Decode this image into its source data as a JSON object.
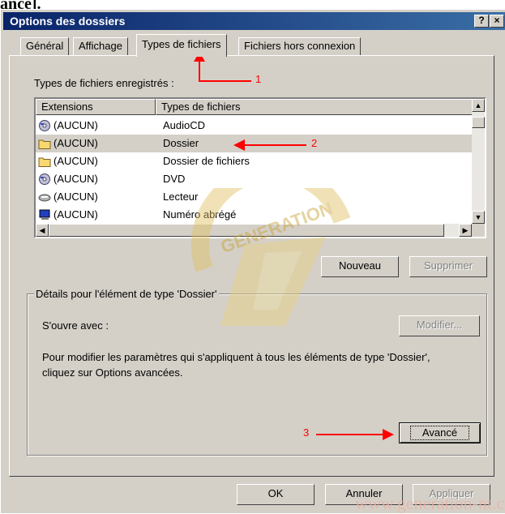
{
  "page_top_fragment": "ancé].",
  "window": {
    "title": "Options des dossiers",
    "help_label": "?",
    "close_label": "×"
  },
  "tabs": [
    {
      "label": "Général"
    },
    {
      "label": "Affichage"
    },
    {
      "label": "Types de fichiers"
    },
    {
      "label": "Fichiers hors connexion"
    }
  ],
  "registered_label": "Types de fichiers enregistrés :",
  "list": {
    "columns": [
      "Extensions",
      "Types de fichiers"
    ],
    "rows": [
      {
        "ext": "(AUCUN)",
        "type": "AudioCD",
        "icon": "cd-icon"
      },
      {
        "ext": "(AUCUN)",
        "type": "Dossier",
        "icon": "folder-icon"
      },
      {
        "ext": "(AUCUN)",
        "type": "Dossier de fichiers",
        "icon": "folder-icon"
      },
      {
        "ext": "(AUCUN)",
        "type": "DVD",
        "icon": "cd-icon"
      },
      {
        "ext": "(AUCUN)",
        "type": "Lecteur",
        "icon": "drive-icon"
      },
      {
        "ext": "(AUCUN)",
        "type": "Numéro abrégé",
        "icon": "computer-icon"
      }
    ],
    "selected_index": 1
  },
  "buttons": {
    "new": "Nouveau",
    "delete": "Supprimer",
    "modify": "Modifier...",
    "advanced": "Avancé",
    "ok": "OK",
    "cancel": "Annuler",
    "apply": "Appliquer"
  },
  "details": {
    "legend": "Détails pour l'élément de type 'Dossier'",
    "opens_with": "S'ouvre avec :",
    "description_line1": "Pour modifier les paramètres qui s'appliquent à tous les éléments de type 'Dossier',",
    "description_line2": "cliquez sur Options avancées."
  },
  "annotations": {
    "one": "1",
    "two": "2",
    "three": "3"
  },
  "watermark": {
    "brand": "GENERATION",
    "url": "www.generation-nt.com"
  },
  "colors": {
    "title_start": "#0a246a",
    "title_end": "#3a6ea5",
    "face": "#d4d0c8",
    "annotation": "#ff0000"
  }
}
